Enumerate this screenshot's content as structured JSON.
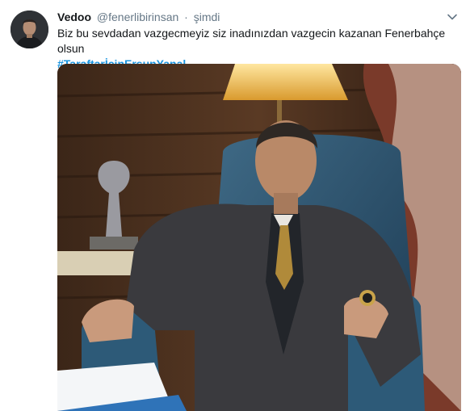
{
  "tweet": {
    "author_name": "Vedoo",
    "author_handle": "@fenerlibirinsan",
    "separator": "·",
    "timestamp": "şimdi",
    "text": "Biz bu sevdadan vazgecmeyiz siz inadınızdan vazgecin kazanan Fenerbahçe olsun",
    "hashtag": "#TaraftarİçinErsunYanal"
  },
  "icons": {
    "more": "chevron-down-icon",
    "avatar": "avatar"
  },
  "colors": {
    "link": "#1b95e0",
    "secondary_text": "#657786",
    "primary_text": "#14171a"
  }
}
